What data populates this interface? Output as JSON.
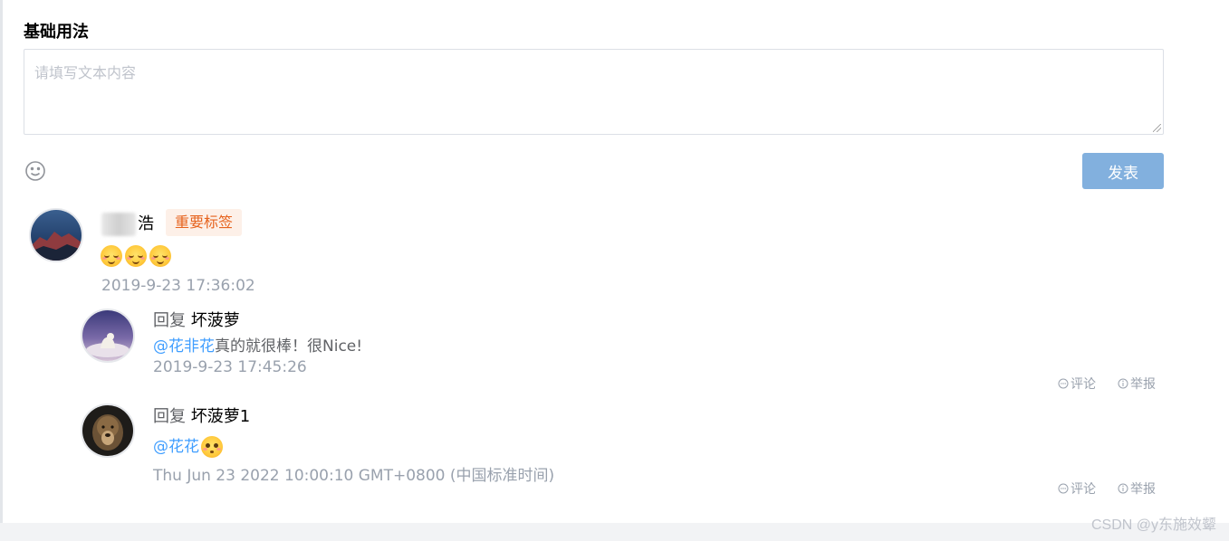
{
  "section": {
    "title": "基础用法"
  },
  "editor": {
    "placeholder": "请填写文本内容",
    "value": ""
  },
  "toolbar": {
    "emoji_icon": "smile-icon",
    "submit_label": "发表"
  },
  "comment": {
    "author_suffix": "浩",
    "tag": "重要标签",
    "emoji_count": 3,
    "time": "2019-9-23 17:36:02"
  },
  "replies": [
    {
      "prefix": "回复",
      "to": "坏菠萝",
      "mention": "@花非花",
      "text": "真的就很棒！很Nice!",
      "time": "2019-9-23 17:45:26",
      "actions": {
        "comment": "评论",
        "report": "举报"
      }
    },
    {
      "prefix": "回复",
      "to": "坏菠萝1",
      "mention": "@花花",
      "text": "",
      "time": "Thu Jun 23 2022 10:00:10 GMT+0800 (中国标准时间)",
      "actions": {
        "comment": "评论",
        "report": "举报"
      }
    }
  ],
  "watermark": "CSDN @y东施效颦",
  "colors": {
    "link": "#409eff",
    "tag_text": "#e6631e",
    "tag_bg": "#fdf0e8",
    "button": "#82b0de",
    "muted": "#99a1ad"
  }
}
